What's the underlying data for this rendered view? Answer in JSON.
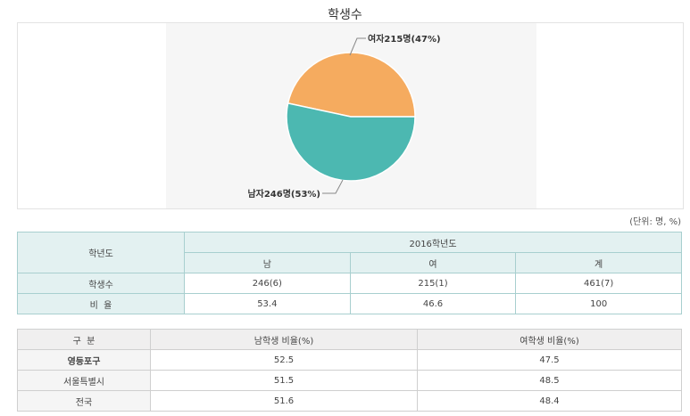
{
  "title": "학생수",
  "chart_data": {
    "type": "pie",
    "slices": [
      {
        "label": "여자215명(47%)",
        "value": 215,
        "percent": 47,
        "color": "#f5ab5f"
      },
      {
        "label": "남자246명(53%)",
        "value": 246,
        "percent": 53,
        "color": "#4cb8b1"
      }
    ]
  },
  "unit_note": "(단위: 명, %)",
  "table1": {
    "row_header": "학년도",
    "year": "2016학년도",
    "cols": [
      "남",
      "여",
      "계"
    ],
    "rows": [
      {
        "label": "학생수",
        "values": [
          "246(6)",
          "215(1)",
          "461(7)"
        ]
      },
      {
        "label": "비  율",
        "values": [
          "53.4",
          "46.6",
          "100"
        ]
      }
    ]
  },
  "table2": {
    "headers": [
      "구  분",
      "남학생 비율(%)",
      "여학생 비율(%)"
    ],
    "rows": [
      {
        "label": "영등포구",
        "values": [
          "52.5",
          "47.5"
        ]
      },
      {
        "label": "서울특별시",
        "values": [
          "51.5",
          "48.5"
        ]
      },
      {
        "label": "전국",
        "values": [
          "51.6",
          "48.4"
        ]
      }
    ]
  }
}
